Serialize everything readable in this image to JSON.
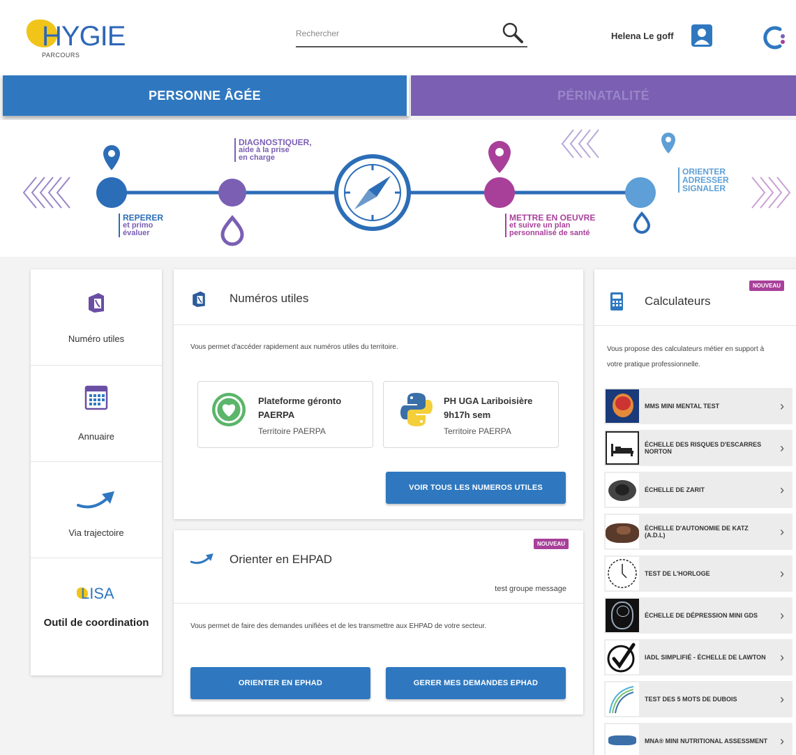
{
  "header": {
    "logo_text": "HYGIE",
    "logo_sub": "PARCOURS",
    "search_placeholder": "Rechercher",
    "user_name": "Helena Le goff"
  },
  "tabs": [
    {
      "label": "PERSONNE ÂGÉE",
      "active": true
    },
    {
      "label": "PÉRINATALITÉ",
      "active": false
    }
  ],
  "timeline": {
    "step1_title": "REPERER",
    "step1_sub": "et primo",
    "step1_sub2": "évaluer",
    "step2_title": "DIAGNOSTIQUER,",
    "step2_sub": "aide à la prise",
    "step2_sub2": "en charge",
    "step3_title": "METTRE EN OEUVRE",
    "step3_sub": "et suivre un plan",
    "step3_sub2": "personnalisé de santé",
    "step4_line1": "ORIENTER",
    "step4_line2": "ADRESSER",
    "step4_line3": "SIGNALER"
  },
  "sidebar": {
    "items": [
      {
        "label": "Numéro utiles"
      },
      {
        "label": "Annuaire"
      },
      {
        "label": "Via trajectoire"
      },
      {
        "label": "Outil de coordination",
        "logo": "LISA"
      }
    ]
  },
  "numeros": {
    "title": "Numéros utiles",
    "description": "Vous permet d'accéder rapidement aux numéros utiles du territoire.",
    "cards": [
      {
        "title": "Plateforme géronto PAERPA",
        "territory": "Territoire PAERPA"
      },
      {
        "title": "PH UGA Lariboisière 9h17h sem",
        "territory": "Territoire PAERPA"
      }
    ],
    "button": "VOIR TOUS LES NUMEROS UTILES"
  },
  "ehpad": {
    "badge": "NOUVEAU",
    "title": "Orienter en EHPAD",
    "group": "test groupe message",
    "description": "Vous permet de faire des demandes unifiées et de les transmettre aux EHPAD de votre secteur.",
    "button1": "ORIENTER EN EPHAD",
    "button2": "GERER MES DEMANDES EPHAD"
  },
  "calculateurs": {
    "badge": "NOUVEAU",
    "title": "Calculateurs",
    "description": "Vous propose des calculateurs métier en support à votre pratique professionnelle.",
    "items": [
      {
        "label": "MMS MINI MENTAL TEST"
      },
      {
        "label": "ÉCHELLE DES RISQUES D'ESCARRES NORTON"
      },
      {
        "label": "ÉCHELLE DE ZARIT"
      },
      {
        "label": "ÉCHELLE D'AUTONOMIE DE KATZ (A.D.L)"
      },
      {
        "label": "TEST DE L'HORLOGE"
      },
      {
        "label": "ÉCHELLE DE DÉPRESSION MINI GDS"
      },
      {
        "label": "IADL SIMPLIFIÉ - ÉCHELLE DE LAWTON"
      },
      {
        "label": "TEST DES 5 MOTS DE DUBOIS"
      },
      {
        "label": "MNA® MINI NUTRITIONAL ASSESSMENT"
      }
    ]
  },
  "colors": {
    "blue": "#2f78c0",
    "purple": "#7a5fb3",
    "magenta": "#a8409a",
    "light_blue": "#5d9fd6"
  }
}
